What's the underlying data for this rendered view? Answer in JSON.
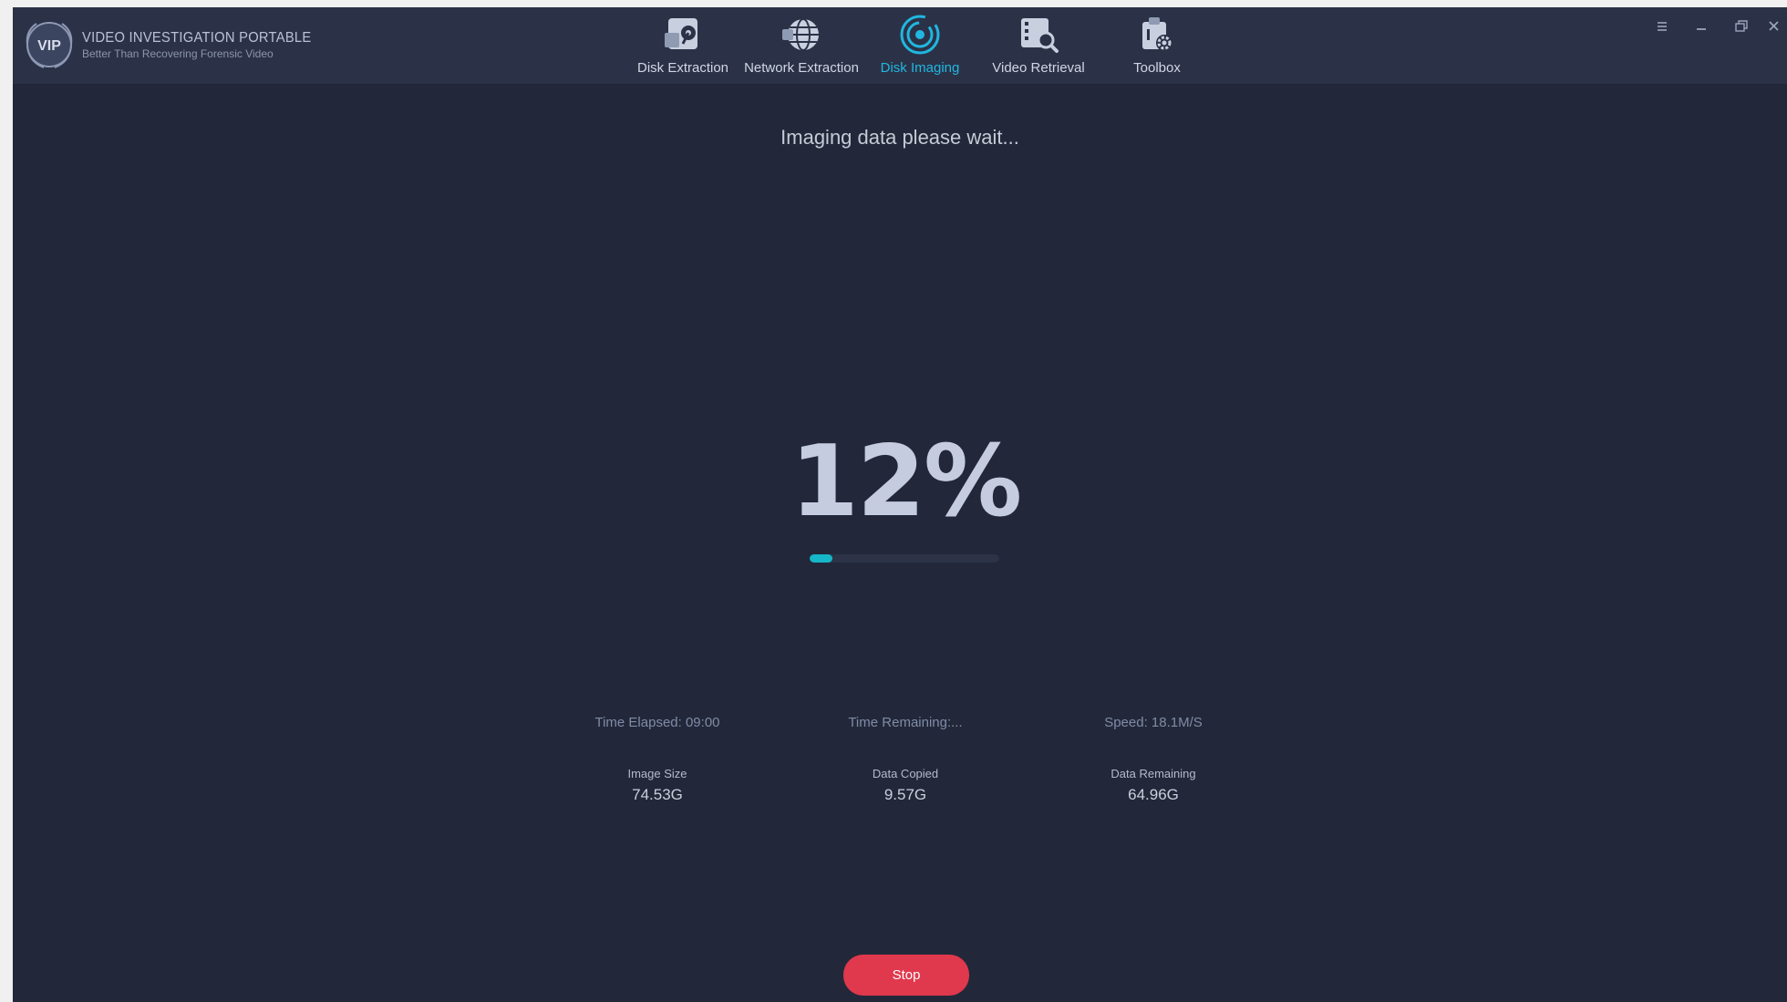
{
  "app": {
    "logo_badge_text": "VIP",
    "title": "VIDEO INVESTIGATION PORTABLE",
    "subtitle": "Better Than Recovering Forensic Video"
  },
  "nav": {
    "tabs": [
      {
        "label": "Disk Extraction",
        "icon": "disk-extraction-icon",
        "active": false
      },
      {
        "label": "Network Extraction",
        "icon": "network-globe-icon",
        "active": false
      },
      {
        "label": "Disk Imaging",
        "icon": "disk-imaging-icon",
        "active": true
      },
      {
        "label": "Video Retrieval",
        "icon": "video-search-icon",
        "active": false
      },
      {
        "label": "Toolbox",
        "icon": "toolbox-gear-icon",
        "active": false
      }
    ]
  },
  "window_controls": [
    "menu-icon",
    "minimize-icon",
    "restore-icon",
    "close-icon"
  ],
  "main": {
    "status_text": "Imaging data please wait...",
    "percent_text": "12%",
    "progress_fraction": 0.12,
    "stats_line": {
      "elapsed": "Time Elapsed: 09:00",
      "remaining": "Time Remaining:...",
      "speed": "Speed: 18.1M/S"
    },
    "stats": [
      {
        "title": "Image Size",
        "value": "74.53G"
      },
      {
        "title": "Data Copied",
        "value": "9.57G"
      },
      {
        "title": "Data Remaining",
        "value": "64.96G"
      }
    ],
    "stop_label": "Stop"
  },
  "colors": {
    "background": "#222839",
    "header": "#2b3247",
    "accent": "#15b7c9",
    "active_tab": "#20b7e0",
    "stop_button": "#e0384d"
  }
}
